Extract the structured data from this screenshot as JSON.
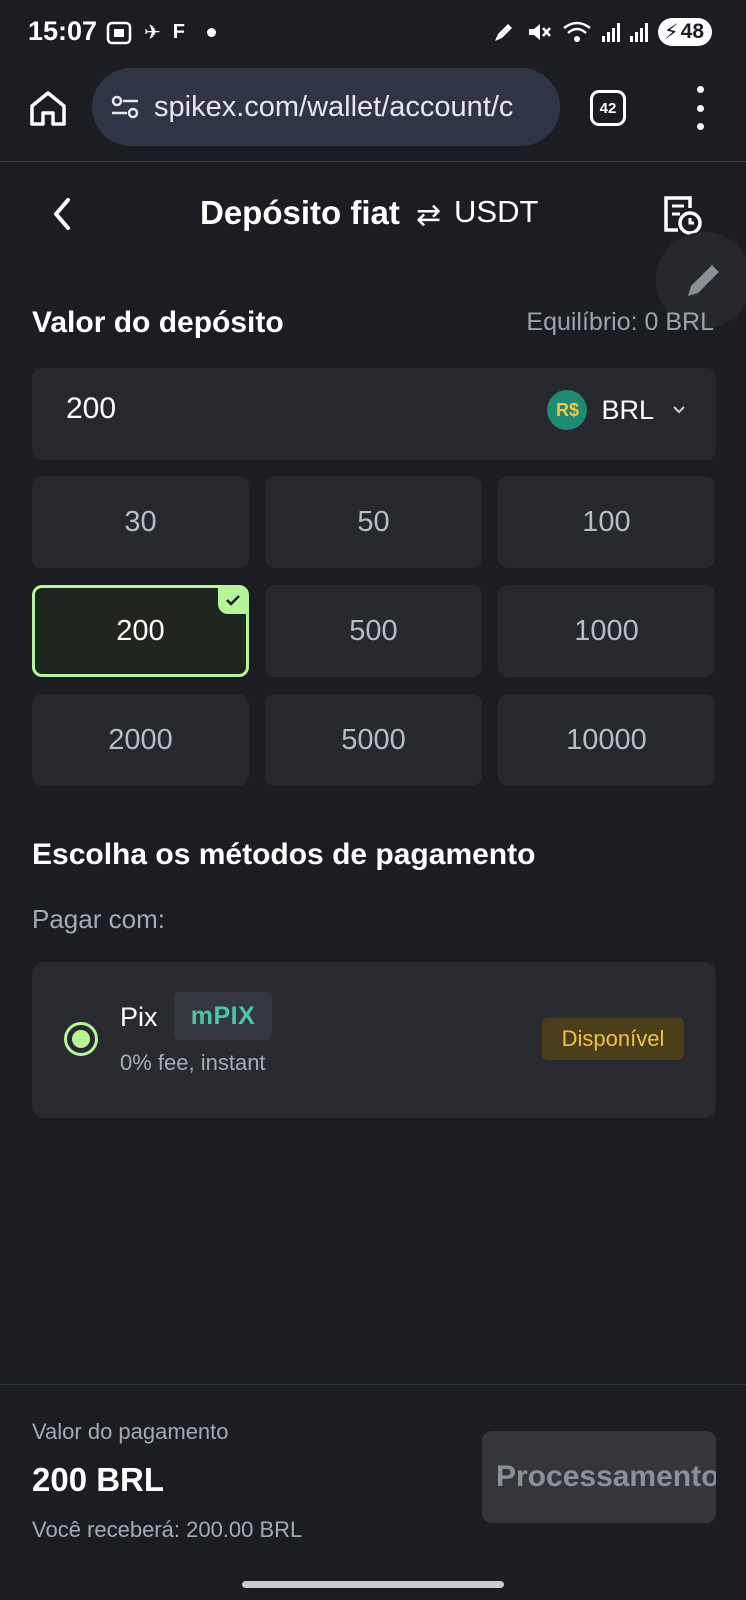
{
  "status_bar": {
    "time": "15:07",
    "battery": "48",
    "icons": [
      "screenshot-icon",
      "app-icon",
      "app-f-icon",
      "notification-dot",
      "mute-icon",
      "wifi-icon",
      "signal-icon"
    ]
  },
  "browser": {
    "url": "spikex.com/wallet/account/c",
    "tab_count": "42"
  },
  "header": {
    "title": "Depósito fiat",
    "switch_label": "USDT"
  },
  "deposit": {
    "section_title": "Valor do depósito",
    "balance": "Equilíbrio: 0 BRL",
    "amount": "200",
    "currency_symbol": "R$",
    "currency": "BRL",
    "options": [
      "30",
      "50",
      "100",
      "200",
      "500",
      "1000",
      "2000",
      "5000",
      "10000"
    ],
    "selected": "200"
  },
  "payment": {
    "section_title": "Escolha os métodos de pagamento",
    "pay_with": "Pagar com:",
    "method": {
      "name": "Pix",
      "logo_text": "mPIX",
      "description": "0% fee, instant",
      "status": "Disponível"
    }
  },
  "footer": {
    "pay_value_label": "Valor do pagamento",
    "pay_value": "200 BRL",
    "receive": "Você receberá: 200.00 BRL",
    "button": "Processamento"
  },
  "colors": {
    "background": "#1b1d22",
    "card": "#26282d",
    "accent_green": "#b7f59a",
    "badge_text": "#f0c04a",
    "badge_bg": "#4b3f1a"
  }
}
